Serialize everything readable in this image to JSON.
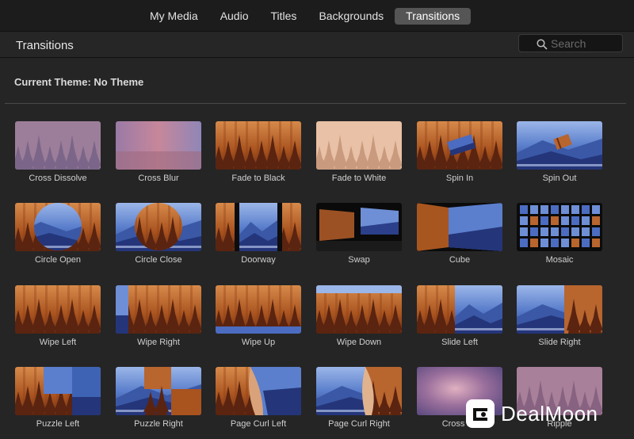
{
  "tabs": [
    {
      "label": "My Media",
      "active": false
    },
    {
      "label": "Audio",
      "active": false
    },
    {
      "label": "Titles",
      "active": false
    },
    {
      "label": "Backgrounds",
      "active": false
    },
    {
      "label": "Transitions",
      "active": true
    }
  ],
  "header": {
    "title": "Transitions",
    "search_placeholder": "Search"
  },
  "theme_label": "Current Theme: No Theme",
  "transitions": [
    {
      "label": "Cross Dissolve",
      "style": "dissolve"
    },
    {
      "label": "Cross Blur",
      "style": "blur"
    },
    {
      "label": "Fade to Black",
      "style": "forest"
    },
    {
      "label": "Fade to White",
      "style": "white"
    },
    {
      "label": "Spin In",
      "style": "spin-in"
    },
    {
      "label": "Spin Out",
      "style": "spin-out"
    },
    {
      "label": "Circle Open",
      "style": "circle-open"
    },
    {
      "label": "Circle Close",
      "style": "circle-close"
    },
    {
      "label": "Doorway",
      "style": "doorway"
    },
    {
      "label": "Swap",
      "style": "swap"
    },
    {
      "label": "Cube",
      "style": "cube"
    },
    {
      "label": "Mosaic",
      "style": "mosaic"
    },
    {
      "label": "Wipe Left",
      "style": "forest"
    },
    {
      "label": "Wipe Right",
      "style": "wipe-right"
    },
    {
      "label": "Wipe Up",
      "style": "wipe-up"
    },
    {
      "label": "Wipe Down",
      "style": "wipe-down"
    },
    {
      "label": "Slide Left",
      "style": "slide-left"
    },
    {
      "label": "Slide Right",
      "style": "slide-right"
    },
    {
      "label": "Puzzle Left",
      "style": "puzzle-left"
    },
    {
      "label": "Puzzle Right",
      "style": "puzzle-right"
    },
    {
      "label": "Page Curl Left",
      "style": "curl-left"
    },
    {
      "label": "Page Curl Right",
      "style": "curl-right"
    },
    {
      "label": "Cross Zo",
      "style": "zoom"
    },
    {
      "label": "Ripple",
      "style": "ripple"
    }
  ],
  "watermark": {
    "text": "DealMoon",
    "icon": "dealmoon-logo-icon"
  },
  "colors": {
    "active_tab": "#555555",
    "forest": "#b8652e",
    "mountain": "#3f63b4"
  }
}
